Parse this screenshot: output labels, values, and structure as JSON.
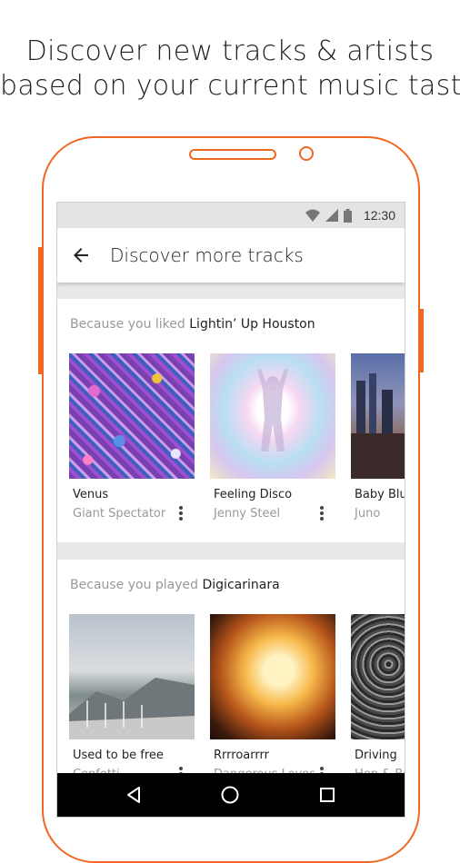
{
  "headline": {
    "line1": "Discover new tracks & artists",
    "line2": "based on your current music taste"
  },
  "colors": {
    "accent": "#f26722"
  },
  "status_bar": {
    "time": "12:30",
    "icons": [
      "wifi-icon",
      "signal-icon",
      "battery-icon"
    ]
  },
  "app_bar": {
    "back_icon": "arrow-back-icon",
    "title": "Discover more tracks"
  },
  "sections": [
    {
      "prefix": "Because you liked",
      "subject": "Lightin’ Up Houston",
      "tracks": [
        {
          "title": "Venus",
          "artist": "Giant Spectator"
        },
        {
          "title": "Feeling Disco",
          "artist": "Jenny Steel"
        },
        {
          "title": "Baby Blue",
          "artist": "Juno"
        }
      ]
    },
    {
      "prefix": "Because you played",
      "subject": "Digicarinara",
      "tracks": [
        {
          "title": "Used to be free",
          "artist": "Confetti"
        },
        {
          "title": "Rrrroarrrr",
          "artist": "Dangerous Loves"
        },
        {
          "title": "Driving",
          "artist": "Hep & Bu"
        }
      ]
    }
  ],
  "nav_bar": {
    "icons": [
      "back-triangle-icon",
      "home-circle-icon",
      "recents-square-icon"
    ]
  }
}
